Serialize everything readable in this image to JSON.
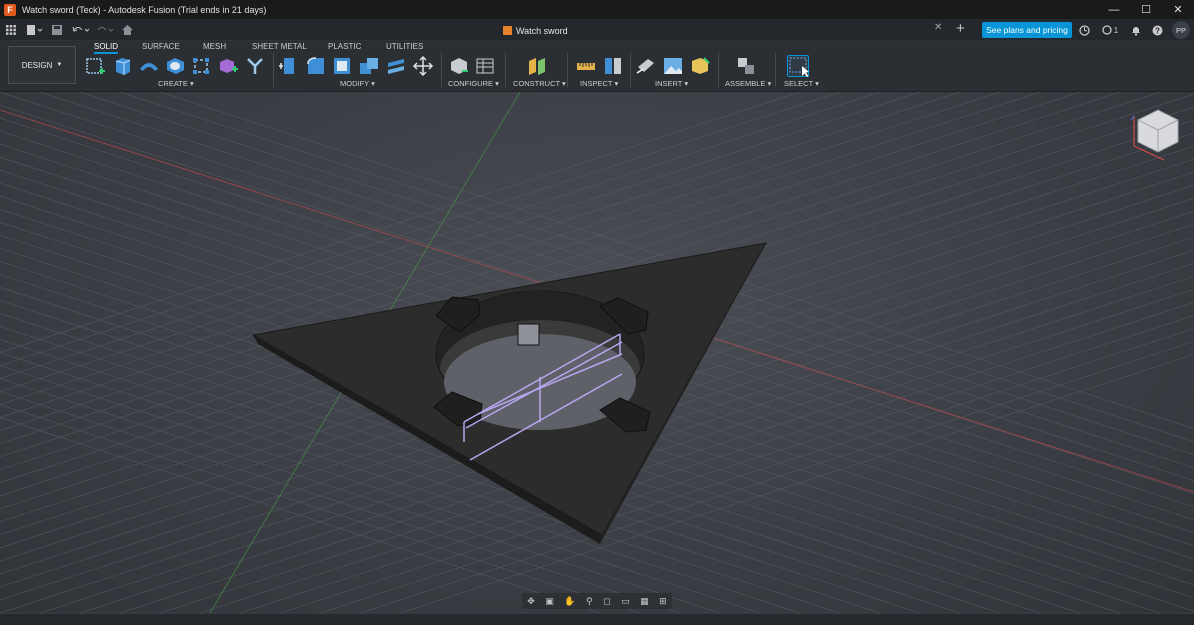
{
  "window": {
    "title": "Watch sword (Teck) - Autodesk Fusion (Trial ends in 21 days)",
    "logo_letter": "F",
    "minimize": "—",
    "maximize": "☐",
    "close": "✕"
  },
  "tabbar": {
    "doc_tab": "Watch sword",
    "plans_button": "See plans and pricing",
    "jobs_count": "1",
    "avatar_initials": "PP"
  },
  "toolbar": {
    "workspace": "DESIGN",
    "mode_tabs": [
      "SOLID",
      "SURFACE",
      "MESH",
      "SHEET METAL",
      "PLASTIC",
      "UTILITIES"
    ],
    "groups": {
      "create": "CREATE",
      "modify": "MODIFY",
      "configure": "CONFIGURE",
      "construct": "CONSTRUCT",
      "inspect": "INSPECT",
      "insert": "INSERT",
      "assemble": "ASSEMBLE",
      "select": "SELECT"
    }
  },
  "colors": {
    "accent": "#0696d7",
    "viewport_bg": "#3d4046",
    "part": "#2a2a2a",
    "sketch": "#b9a6f0"
  },
  "icons": {
    "grid": "grid-icon",
    "file": "file-icon",
    "save": "save-icon",
    "undo": "undo-icon",
    "redo": "redo-icon",
    "home": "home-icon",
    "viewcube": "viewcube-icon"
  }
}
